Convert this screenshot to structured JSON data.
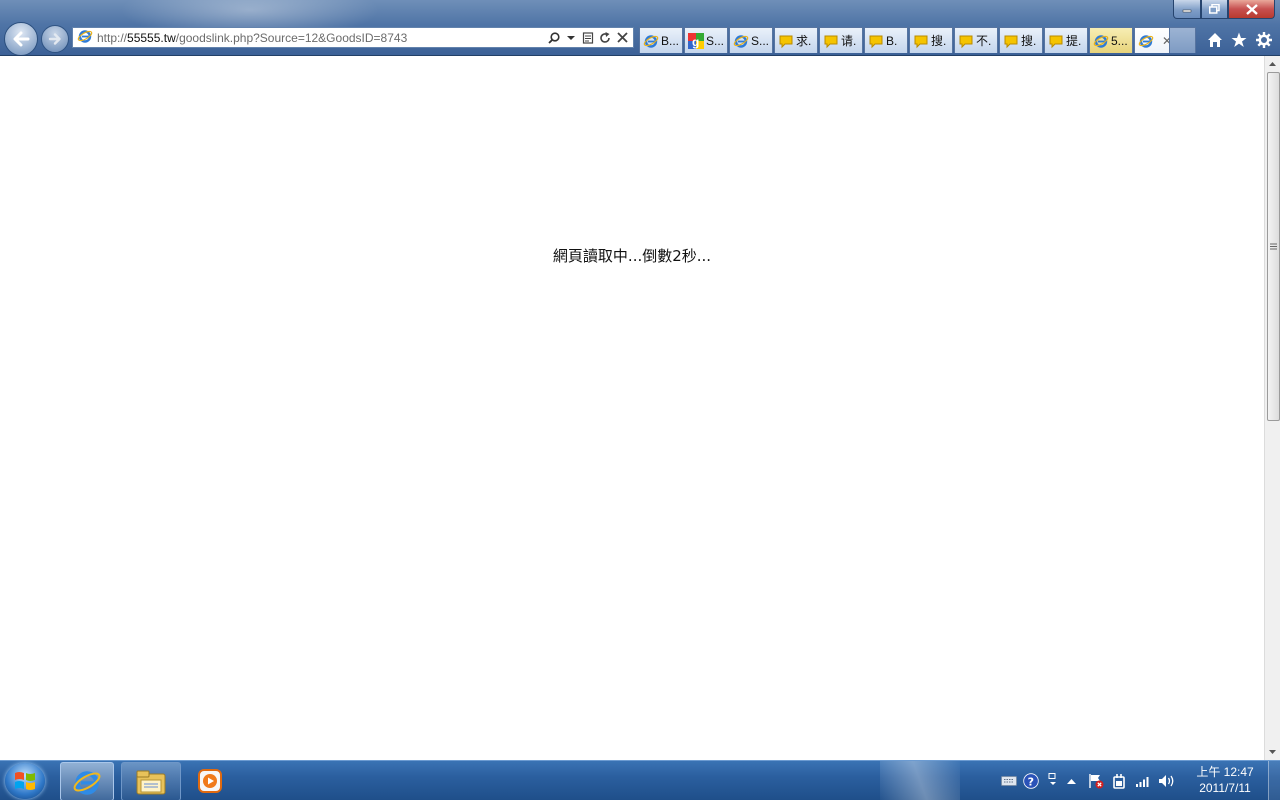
{
  "window": {
    "minimize_icon": "minimize-icon",
    "maximize_icon": "restore-icon",
    "close_icon": "close-icon"
  },
  "nav": {
    "back_icon": "back-arrow-icon",
    "forward_icon": "forward-arrow-icon"
  },
  "address_bar": {
    "scheme": "http://",
    "domain": "55555.tw",
    "path": "/goodslink.php?Source=12&GoodsID=8743"
  },
  "tabs": [
    {
      "icon": "ie-icon",
      "label": "B..."
    },
    {
      "icon": "google-icon",
      "label": "S..."
    },
    {
      "icon": "ie-icon",
      "label": "S..."
    },
    {
      "icon": "yahoo-answers-icon",
      "label": "求."
    },
    {
      "icon": "yahoo-answers-icon",
      "label": "请."
    },
    {
      "icon": "yahoo-answers-icon",
      "label": "B."
    },
    {
      "icon": "yahoo-answers-icon",
      "label": "搜."
    },
    {
      "icon": "yahoo-answers-icon",
      "label": "不."
    },
    {
      "icon": "yahoo-answers-icon",
      "label": "搜."
    },
    {
      "icon": "yahoo-answers-icon",
      "label": "提."
    },
    {
      "icon": "ie-icon",
      "label": "5..."
    },
    {
      "icon": "ie-icon",
      "label": "",
      "active": true
    }
  ],
  "toolbar_right": [
    "home-icon",
    "favorites-star-icon",
    "tools-gear-icon"
  ],
  "page": {
    "message": "網頁讀取中...倒數2秒..."
  },
  "taskbar": {
    "pinned": [
      "internet-explorer-icon",
      "windows-explorer-icon",
      "media-player-icon"
    ],
    "tray_icons": [
      "keyboard-icon",
      "help-icon",
      "display-icon",
      "show-hidden-icons",
      "action-center-flag-icon",
      "power-icon",
      "network-signal-icon",
      "volume-icon"
    ],
    "clock_time": "上午 12:47",
    "clock_date": "2011/7/11"
  },
  "colors": {
    "chrome_blue": "#4f74a6",
    "taskbar_blue": "#2b5f9f",
    "close_red": "#c75050"
  }
}
